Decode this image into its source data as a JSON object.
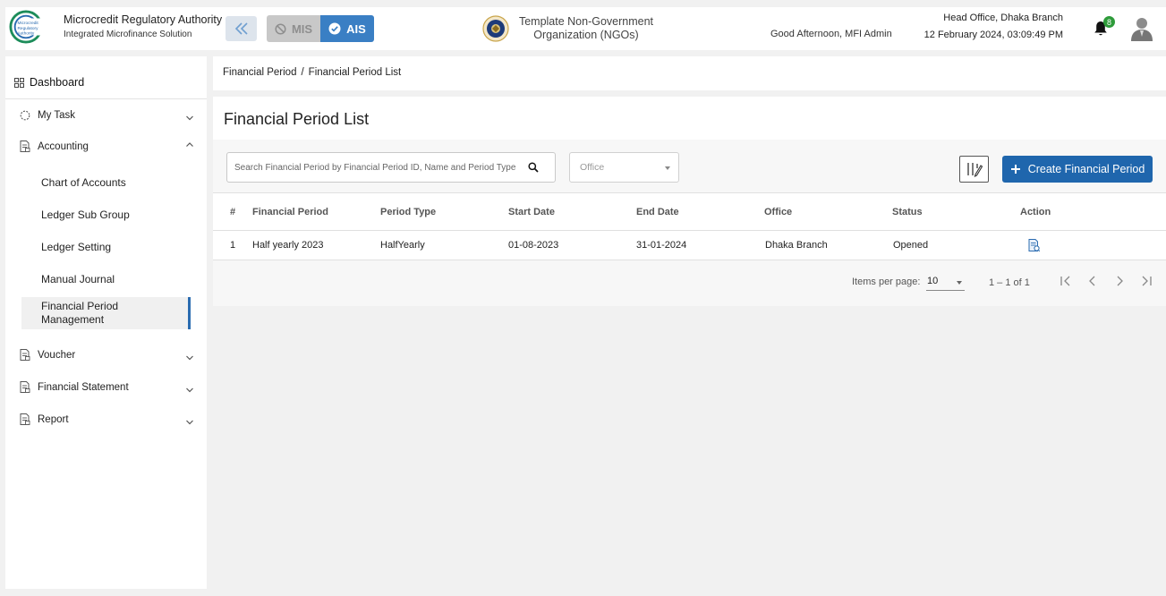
{
  "header": {
    "org_title": "Microcredit Regulatory Authority",
    "org_subtitle": "Integrated Microfinance Solution",
    "logo_text": "Microcredit Regulatory Authority",
    "mis_label": "MIS",
    "ais_label": "AIS",
    "ngo_name": "Template Non-Government Organization (NGOs)",
    "greeting": "Good Afternoon, MFI Admin",
    "branch": "Head Office, Dhaka Branch",
    "datetime": "12 February 2024, 03:09:49 PM",
    "notification_count": "8"
  },
  "sidebar": {
    "dashboard_label": "Dashboard",
    "items": [
      {
        "label": "My Task",
        "icon": "spinner-icon",
        "expanded": false
      },
      {
        "label": "Accounting",
        "icon": "document-icon",
        "expanded": true
      },
      {
        "label": "Voucher",
        "icon": "document-icon",
        "expanded": false
      },
      {
        "label": "Financial Statement",
        "icon": "document-icon",
        "expanded": false
      },
      {
        "label": "Report",
        "icon": "document-icon",
        "expanded": false
      }
    ],
    "accounting_children": [
      {
        "label": "Chart of Accounts"
      },
      {
        "label": "Ledger Sub Group"
      },
      {
        "label": "Ledger Setting"
      },
      {
        "label": "Manual Journal"
      },
      {
        "label": "Financial Period Management",
        "active": true
      }
    ]
  },
  "breadcrumb": {
    "parent": "Financial Period",
    "separator": "/",
    "current": "Financial Period List"
  },
  "page": {
    "title": "Financial Period List",
    "search_placeholder": "Search Financial Period by Financial Period ID, Name and Period Type",
    "office_placeholder": "Office",
    "create_label": "Create Financial Period"
  },
  "table": {
    "columns": [
      "#",
      "Financial Period",
      "Period Type",
      "Start Date",
      "End Date",
      "Office",
      "Status",
      "Action"
    ],
    "rows": [
      {
        "index": "1",
        "name": "Half yearly 2023",
        "period_type": "HalfYearly",
        "start": "01-08-2023",
        "end": "31-01-2024",
        "office": "Dhaka Branch",
        "status": "Opened"
      }
    ]
  },
  "pagination": {
    "items_per_page_label": "Items per page:",
    "items_per_page": "10",
    "range": "1 – 1 of 1"
  },
  "colors": {
    "primary": "#1f66ad",
    "ais_active": "#3a7fc4",
    "mis_inactive": "#c8c8c8",
    "badge": "#2e9b3a",
    "active_indicator": "#2a6bb0"
  }
}
